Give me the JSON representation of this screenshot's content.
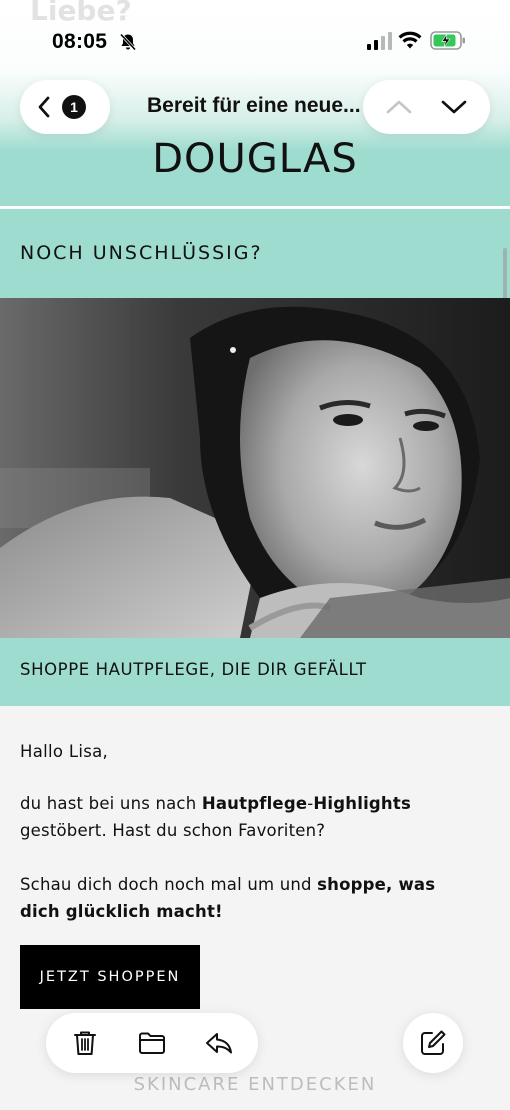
{
  "status_bar": {
    "time": "08:05"
  },
  "header": {
    "unread_count": "1",
    "subject": "Bereit für eine neue...",
    "ghost_title": "Liebe?"
  },
  "email": {
    "brand_logo": "DOUGLAS",
    "banner_1": "NOCH UNSCHLÜSSIG?",
    "banner_2": "SHOPPE HAUTPFLEGE, DIE DIR GEFÄLLT",
    "greeting": "Hallo Lisa,",
    "paragraph_1": {
      "part_1": "du hast bei uns nach ",
      "bold_1": "Hautpflege",
      "part_2": "-",
      "bold_2": "Highlights",
      "part_3": " gestöbert. Hast du schon Favoriten?"
    },
    "paragraph_2": {
      "part_1": "Schau dich doch noch mal um und ",
      "bold_1": "shoppe, was dich glücklich macht!"
    },
    "cta_label": "JETZT SHOPPEN",
    "footer_link": "SKINCARE ENTDECKEN"
  },
  "colors": {
    "accent_mint": "#9fdcd0",
    "cta_black": "#000000",
    "battery_green": "#34c759"
  },
  "icons": {
    "status": [
      "bell-slash-icon",
      "cellular-signal-icon",
      "wifi-icon",
      "battery-charging-icon"
    ],
    "header": [
      "chevron-left-icon",
      "chevron-up-icon",
      "chevron-down-icon"
    ],
    "toolbar": [
      "trash-icon",
      "folder-icon",
      "reply-icon",
      "compose-icon"
    ]
  }
}
